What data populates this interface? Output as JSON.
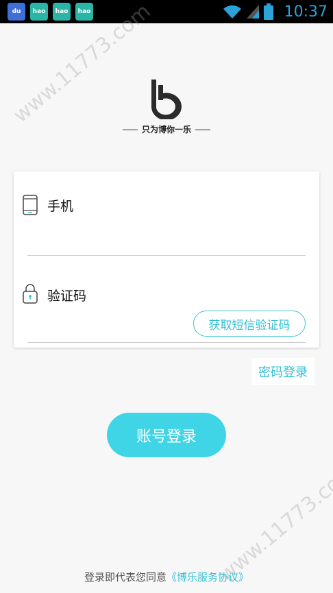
{
  "status_bar": {
    "notifications": [
      {
        "name": "baidu-icon",
        "label": "du"
      },
      {
        "name": "hao-icon",
        "label": "hao"
      },
      {
        "name": "hao-icon",
        "label": "hao"
      },
      {
        "name": "hao-icon",
        "label": "hao"
      }
    ],
    "clock": "10:37"
  },
  "watermark": "www.11773.com",
  "brand": {
    "slogan": "只为博你一乐"
  },
  "form": {
    "phone_label": "手机",
    "code_label": "验证码",
    "sms_button": "获取短信验证码"
  },
  "password_login": "密码登录",
  "account_login": "账号登录",
  "agreement": {
    "prefix": "登录即代表您同意",
    "link": "《博乐服务协议》"
  },
  "colors": {
    "accent": "#3fd4e6",
    "accent_text": "#33c0d3",
    "background": "#f7f7f7"
  }
}
